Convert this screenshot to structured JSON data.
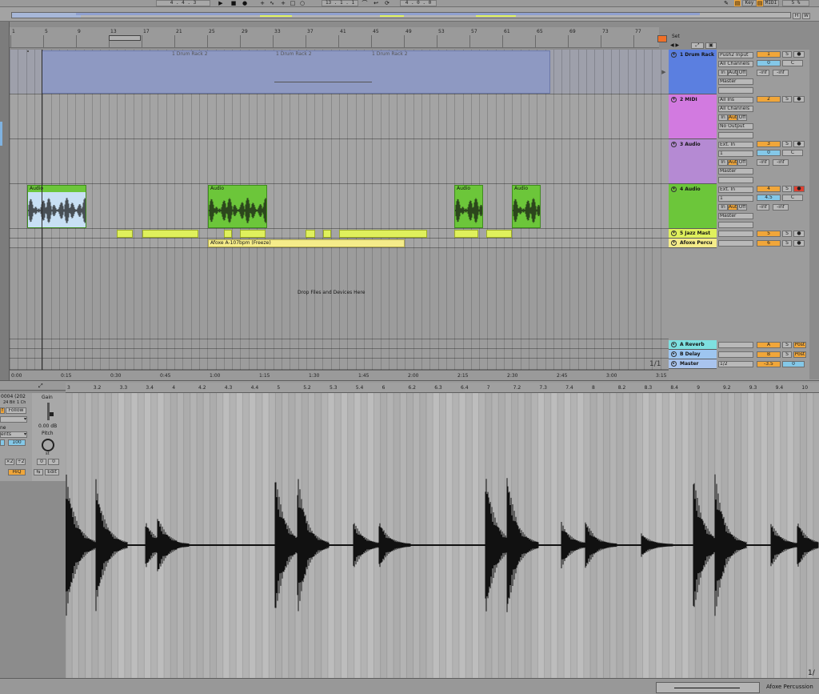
{
  "transport": {
    "tempo_sig": "4 . 4 . 3",
    "position": "13 . 1 . 1",
    "loop_len": "4 . 0 . 0",
    "key_label": "Key",
    "midi_label": "MIDI",
    "cpu": "5 %",
    "h_label": "H",
    "w_label": "W"
  },
  "ruler": {
    "bars": [
      "1",
      "5",
      "9",
      "13",
      "17",
      "21",
      "25",
      "29",
      "33",
      "37",
      "41",
      "45",
      "49",
      "53",
      "57",
      "61",
      "65",
      "69",
      "73",
      "77"
    ],
    "times": [
      "0:00",
      "0:15",
      "0:30",
      "0:45",
      "1:00",
      "1:15",
      "1:30",
      "1:45",
      "2:00",
      "2:15",
      "2:30",
      "2:45",
      "3:00",
      "3:15"
    ],
    "set_label": "Set"
  },
  "drumrack_clips": [
    "1 Drum Rack 2",
    "1 Drum Rack 2",
    "1 Drum Rack 2"
  ],
  "tracks": [
    {
      "name": "1 Drum Rack",
      "color": "#5b7fe0",
      "input": "Push2 Input",
      "chan": "All Channels",
      "num": "1",
      "pan_val": "0",
      "pan": "C",
      "monitor": [
        "In",
        "Auto",
        "Off"
      ],
      "out": "Master",
      "vol": "-inf",
      "vol2": "-inf"
    },
    {
      "name": "2 MIDI",
      "color": "#d27ae0",
      "input": "All Ins",
      "chan": "All Channels",
      "num": "2",
      "monitor": [
        "In",
        "Auto",
        "Off"
      ],
      "out": "No Output"
    },
    {
      "name": "3 Audio",
      "color": "#b58ad3",
      "input": "Ext. In",
      "chan": "1",
      "num": "3",
      "pan_val": "0",
      "pan": "C",
      "monitor": [
        "In",
        "Auto",
        "Off"
      ],
      "out": "Master",
      "vol": "-inf",
      "vol2": "-inf"
    },
    {
      "name": "4 Audio",
      "color": "#6cc63a",
      "input": "Ext. In",
      "chan": "1",
      "num": "4",
      "pan_val": "4.5",
      "pan": "C",
      "monitor": [
        "In",
        "Auto",
        "Off"
      ],
      "out": "Master",
      "vol": "-inf",
      "vol2": "-inf"
    },
    {
      "name": "5 Jazz Mast",
      "color": "#dff05c",
      "num": "5"
    },
    {
      "name": "Afoxe Percu",
      "color": "#f5ec8a",
      "num": "6"
    }
  ],
  "audio_clip_label": "Audio",
  "freeze_clip": "Afoxe A-107bpm (Freeze)",
  "drop_text": "Drop Files and Devices Here",
  "zoom_page": "1/1",
  "returns": [
    {
      "name": "A Reverb",
      "color": "#7ee0e0",
      "num": "A",
      "post": "Post"
    },
    {
      "name": "B Delay",
      "color": "#9ec6f0",
      "num": "B",
      "post": "Post"
    },
    {
      "name": "Master",
      "color": "#a9c4ee",
      "chan": "1/2",
      "num": "-3.5",
      "pan": "0"
    }
  ],
  "mixer_btn": {
    "solo": "S"
  },
  "clipview": {
    "file_info": "0004 (202",
    "bits": "24 Bit",
    "chans": "1 Ch",
    "follow": "Follow",
    "gain_label": "Gain",
    "gain_val": "0.00 dB",
    "pitch_label": "Pitch",
    "st": "st",
    "transpose": "0",
    "detune": "0",
    "warp_mode": "ne",
    "warp_sub": "ents",
    "warp_val": "100",
    "x2": "×2",
    "div2": "÷2",
    "hiq": "HiQ",
    "edit": "Edit",
    "follow_icon": "f"
  },
  "sample_ruler": [
    "3",
    "3.2",
    "3.3",
    "3.4",
    "4",
    "4.2",
    "4.3",
    "4.4",
    "5",
    "5.2",
    "5.3",
    "5.4",
    "6",
    "6.2",
    "6.3",
    "6.4",
    "7",
    "7.2",
    "7.3",
    "7.4",
    "8",
    "8.2",
    "8.3",
    "8.4",
    "9",
    "9.2",
    "9.3",
    "9.4",
    "10"
  ],
  "bottom": {
    "track_name": "Afoxe Percussion",
    "page": "1/"
  }
}
